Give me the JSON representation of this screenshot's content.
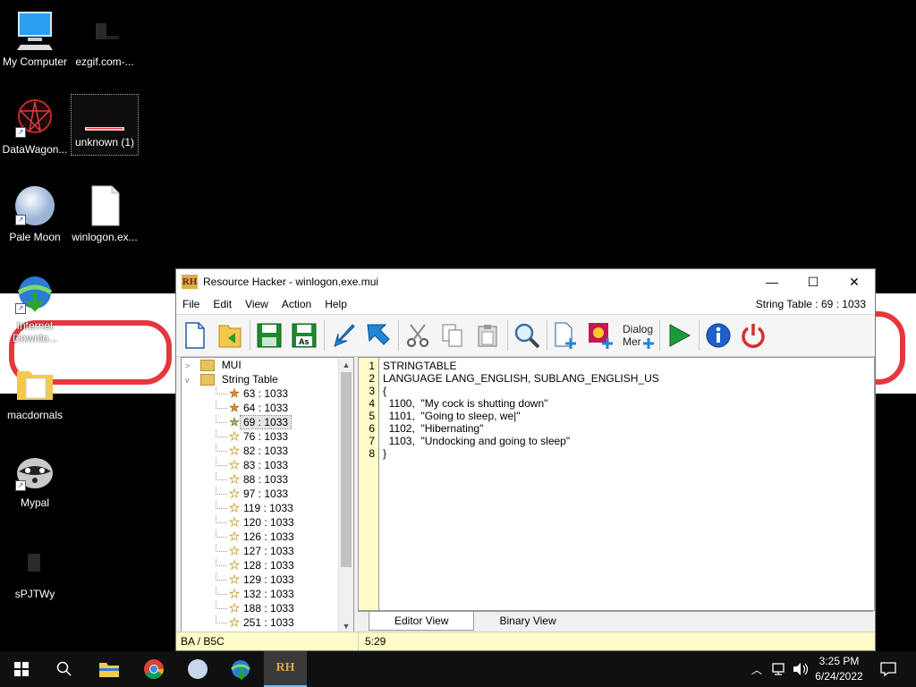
{
  "desktop": {
    "icons": [
      {
        "label": "My Computer"
      },
      {
        "label": "ezgif.com-..."
      },
      {
        "label": "DataWagon..."
      },
      {
        "label": "unknown (1)"
      },
      {
        "label": "Pale Moon"
      },
      {
        "label": "winlogon.ex..."
      },
      {
        "label": "Internet Downlo..."
      },
      {
        "label": "macdornals"
      },
      {
        "label": "Mypal"
      },
      {
        "label": "sPJTWy"
      }
    ]
  },
  "window": {
    "logo": "RH",
    "title": "Resource Hacker - winlogon.exe.mui",
    "minimize": "—",
    "maximize": "☐",
    "close": "✕",
    "menu": [
      "File",
      "Edit",
      "View",
      "Action",
      "Help"
    ],
    "menu_status": "String Table : 69 : 1033",
    "toolbar": [
      {
        "icon": "new-file-icon"
      },
      {
        "icon": "open-folder-icon"
      },
      {
        "icon": "save-icon"
      },
      {
        "icon": "save-as-icon",
        "text": "As"
      },
      {
        "icon": "arrow-down-left-icon"
      },
      {
        "icon": "arrow-up-left-icon"
      },
      {
        "icon": "cut-icon"
      },
      {
        "icon": "copy-icon"
      },
      {
        "icon": "paste-icon"
      },
      {
        "icon": "search-icon"
      },
      {
        "icon": "add-resource-icon"
      },
      {
        "icon": "add-image-icon"
      },
      {
        "icon": "dialog-merger-icon",
        "text": "Dialog Mer"
      },
      {
        "icon": "compile-run-icon"
      },
      {
        "icon": "info-icon"
      },
      {
        "icon": "power-icon"
      }
    ],
    "tree": {
      "folders": [
        {
          "label": "MUI"
        },
        {
          "label": "String Table"
        }
      ],
      "items": [
        {
          "label": "63 : 1033",
          "star": "orange"
        },
        {
          "label": "64 : 1033",
          "star": "orange"
        },
        {
          "label": "69 : 1033",
          "star": "green",
          "selected": true
        },
        {
          "label": "76 : 1033",
          "star": "outline"
        },
        {
          "label": "82 : 1033",
          "star": "outline"
        },
        {
          "label": "83 : 1033",
          "star": "outline"
        },
        {
          "label": "88 : 1033",
          "star": "outline"
        },
        {
          "label": "97 : 1033",
          "star": "outline"
        },
        {
          "label": "119 : 1033",
          "star": "outline"
        },
        {
          "label": "120 : 1033",
          "star": "outline"
        },
        {
          "label": "126 : 1033",
          "star": "outline"
        },
        {
          "label": "127 : 1033",
          "star": "outline"
        },
        {
          "label": "128 : 1033",
          "star": "outline"
        },
        {
          "label": "129 : 1033",
          "star": "outline"
        },
        {
          "label": "132 : 1033",
          "star": "outline"
        },
        {
          "label": "188 : 1033",
          "star": "outline"
        },
        {
          "label": "251 : 1033",
          "star": "outline"
        }
      ]
    },
    "editor": {
      "line_numbers": [
        "1",
        "2",
        "3",
        "4",
        "5",
        "6",
        "7",
        "8"
      ],
      "lines": [
        "STRINGTABLE",
        "LANGUAGE LANG_ENGLISH, SUBLANG_ENGLISH_US",
        "{",
        "  1100,  \"My cock is shutting down\"",
        "  1101,  \"Going to sleep, we|\"",
        "  1102,  \"Hibernating\"",
        "  1103,  \"Undocking and going to sleep\"",
        "}"
      ]
    },
    "tabs": [
      "Editor View",
      "Binary View"
    ],
    "status_left": "BA / B5C",
    "status_right": "5:29"
  },
  "taskbar": {
    "time": "3:25 PM",
    "date": "6/24/2022",
    "rh_label": "RH"
  },
  "colors": {
    "status_bg": "#fffbc8",
    "wallpaper_scribble": "#e0141c",
    "toolbar_blue": "#1f86d8",
    "toolbar_green": "#1c8a2e"
  }
}
